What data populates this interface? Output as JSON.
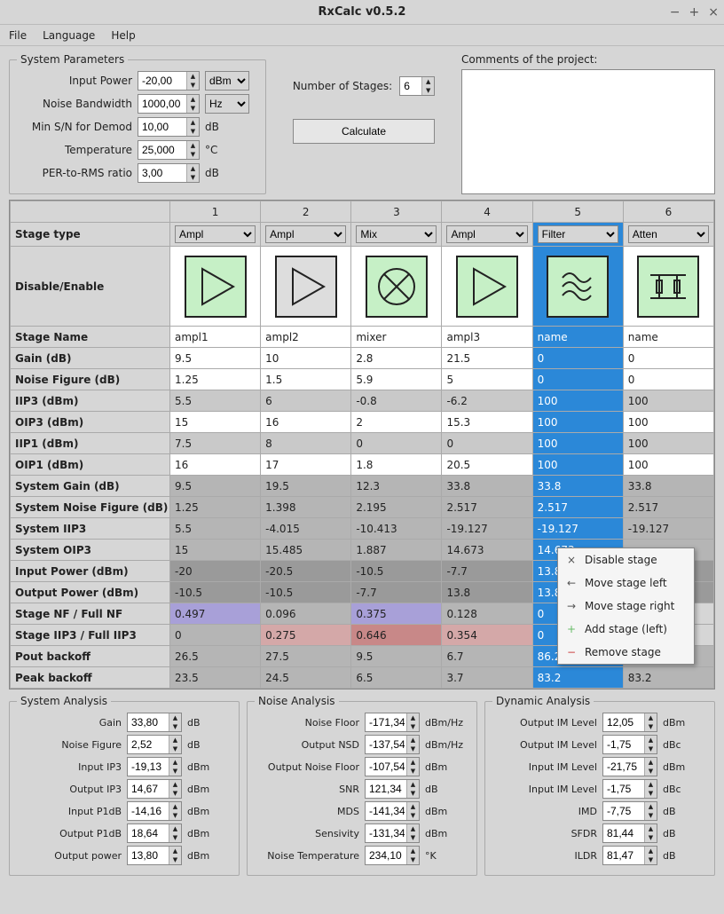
{
  "window": {
    "title": "RxCalc v0.5.2",
    "min": "−",
    "max": "+",
    "close": "×"
  },
  "menu": [
    "File",
    "Language",
    "Help"
  ],
  "sys_params": {
    "legend": "System Parameters",
    "rows": [
      {
        "label": "Input Power",
        "value": "-20,00",
        "unit": "dBm",
        "unit_type": "select"
      },
      {
        "label": "Noise Bandwidth",
        "value": "1000,00",
        "unit": "Hz",
        "unit_type": "select"
      },
      {
        "label": "Min S/N for Demod",
        "value": "10,00",
        "unit": "dB",
        "unit_type": "text"
      },
      {
        "label": "Temperature",
        "value": "25,000",
        "unit": "°C",
        "unit_type": "text"
      },
      {
        "label": "PER-to-RMS ratio",
        "value": "3,00",
        "unit": "dB",
        "unit_type": "text"
      }
    ]
  },
  "num_stages": {
    "label": "Number of Stages:",
    "value": "6"
  },
  "calc_label": "Calculate",
  "comments": {
    "label": "Comments of the project:",
    "value": ""
  },
  "table": {
    "col_headers": [
      "1",
      "2",
      "3",
      "4",
      "5",
      "6"
    ],
    "selected_col": 5,
    "stage_type": {
      "label": "Stage type",
      "values": [
        "Ampl",
        "Ampl",
        "Mix",
        "Ampl",
        "Filter",
        "Atten"
      ]
    },
    "disable_enable": {
      "label": "Disable/Enable",
      "types": [
        "ampl",
        "ampl-dis",
        "mix",
        "ampl",
        "filt",
        "atten"
      ]
    },
    "rows": [
      {
        "hdr": "Stage Name",
        "style": "white",
        "cells": [
          "ampl1",
          "ampl2",
          "mixer",
          "ampl3",
          "name",
          "name"
        ]
      },
      {
        "hdr": "Gain (dB)",
        "style": "white",
        "cells": [
          "9.5",
          "10",
          "2.8",
          "21.5",
          "0",
          "0"
        ]
      },
      {
        "hdr": "Noise Figure (dB)",
        "style": "white",
        "cells": [
          "1.25",
          "1.5",
          "5.9",
          "5",
          "0",
          "0"
        ]
      },
      {
        "hdr": "IIP3 (dBm)",
        "style": "gray1",
        "cells": [
          "5.5",
          "6",
          "-0.8",
          "-6.2",
          "100",
          "100"
        ]
      },
      {
        "hdr": "OIP3 (dBm)",
        "style": "white",
        "cells": [
          "15",
          "16",
          "2",
          "15.3",
          "100",
          "100"
        ]
      },
      {
        "hdr": "IIP1 (dBm)",
        "style": "gray1",
        "cells": [
          "7.5",
          "8",
          "0",
          "0",
          "100",
          "100"
        ]
      },
      {
        "hdr": "OIP1 (dBm)",
        "style": "white",
        "cells": [
          "16",
          "17",
          "1.8",
          "20.5",
          "100",
          "100"
        ]
      },
      {
        "hdr": "System Gain (dB)",
        "style": "gray2",
        "cells": [
          "9.5",
          "19.5",
          "12.3",
          "33.8",
          "33.8",
          "33.8"
        ]
      },
      {
        "hdr": "System Noise Figure (dB)",
        "style": "gray2",
        "cells": [
          "1.25",
          "1.398",
          "2.195",
          "2.517",
          "2.517",
          "2.517"
        ]
      },
      {
        "hdr": "System IIP3",
        "style": "gray2",
        "cells": [
          "5.5",
          "-4.015",
          "-10.413",
          "-19.127",
          "-19.127",
          "-19.127"
        ]
      },
      {
        "hdr": "System OIP3",
        "style": "gray2",
        "cells": [
          "15",
          "15.485",
          "1.887",
          "14.673",
          "14.673",
          ""
        ]
      },
      {
        "hdr": "Input Power (dBm)",
        "style": "gray3",
        "cells": [
          "-20",
          "-20.5",
          "-10.5",
          "-7.7",
          "13.8",
          ""
        ]
      },
      {
        "hdr": "Output Power (dBm)",
        "style": "gray3",
        "cells": [
          "-10.5",
          "-10.5",
          "-7.7",
          "13.8",
          "13.8",
          ""
        ]
      },
      {
        "hdr": "Stage NF / Full NF",
        "style": "purple",
        "cells": [
          "0.497",
          "0.096",
          "0.375",
          "0.128",
          "0",
          ""
        ],
        "cell_styles": [
          "purple",
          "gray2",
          "purple",
          "gray2",
          "sel",
          ""
        ]
      },
      {
        "hdr": "Stage IIP3 / Full IIP3",
        "style": "red",
        "cells": [
          "0",
          "0.275",
          "0.646",
          "0.354",
          "0",
          ""
        ],
        "cell_styles": [
          "gray2",
          "red1",
          "red2",
          "red1",
          "sel",
          ""
        ]
      },
      {
        "hdr": "Pout backoff",
        "style": "gray2",
        "cells": [
          "26.5",
          "27.5",
          "9.5",
          "6.7",
          "86.2",
          ""
        ]
      },
      {
        "hdr": "Peak backoff",
        "style": "gray2",
        "cells": [
          "23.5",
          "24.5",
          "6.5",
          "3.7",
          "83.2",
          "83.2"
        ]
      }
    ]
  },
  "context_menu": {
    "items": [
      {
        "icon": "×",
        "label": "Disable stage"
      },
      {
        "icon": "←",
        "label": "Move stage left"
      },
      {
        "icon": "→",
        "label": "Move stage right"
      },
      {
        "icon": "+",
        "label": "Add stage (left)",
        "color": "#6b6"
      },
      {
        "icon": "−",
        "label": "Remove stage",
        "color": "#c44"
      }
    ]
  },
  "sys_analysis": {
    "legend": "System Analysis",
    "rows": [
      {
        "label": "Gain",
        "value": "33,80",
        "unit": "dB"
      },
      {
        "label": "Noise Figure",
        "value": "2,52",
        "unit": "dB"
      },
      {
        "label": "Input IP3",
        "value": "-19,13",
        "unit": "dBm"
      },
      {
        "label": "Output IP3",
        "value": "14,67",
        "unit": "dBm"
      },
      {
        "label": "Input P1dB",
        "value": "-14,16",
        "unit": "dBm"
      },
      {
        "label": "Output P1dB",
        "value": "18,64",
        "unit": "dBm"
      },
      {
        "label": "Output power",
        "value": "13,80",
        "unit": "dBm"
      }
    ]
  },
  "noise_analysis": {
    "legend": "Noise Analysis",
    "rows": [
      {
        "label": "Noise Floor",
        "value": "-171,34",
        "unit": "dBm/Hz"
      },
      {
        "label": "Output NSD",
        "value": "-137,54",
        "unit": "dBm/Hz"
      },
      {
        "label": "Output Noise Floor",
        "value": "-107,54",
        "unit": "dBm"
      },
      {
        "label": "SNR",
        "value": "121,34",
        "unit": "dB"
      },
      {
        "label": "MDS",
        "value": "-141,34",
        "unit": "dBm"
      },
      {
        "label": "Sensivity",
        "value": "-131,34",
        "unit": "dBm"
      },
      {
        "label": "Noise Temperature",
        "value": "234,10",
        "unit": "°K"
      }
    ]
  },
  "dyn_analysis": {
    "legend": "Dynamic Analysis",
    "rows": [
      {
        "label": "Output IM Level",
        "value": "12,05",
        "unit": "dBm"
      },
      {
        "label": "Output IM Level",
        "value": "-1,75",
        "unit": "dBc"
      },
      {
        "label": "Input IM Level",
        "value": "-21,75",
        "unit": "dBm"
      },
      {
        "label": "Input IM Level",
        "value": "-1,75",
        "unit": "dBc"
      },
      {
        "label": "IMD",
        "value": "-7,75",
        "unit": "dB"
      },
      {
        "label": "SFDR",
        "value": "81,44",
        "unit": "dB"
      },
      {
        "label": "ILDR",
        "value": "81,47",
        "unit": "dB"
      }
    ]
  }
}
